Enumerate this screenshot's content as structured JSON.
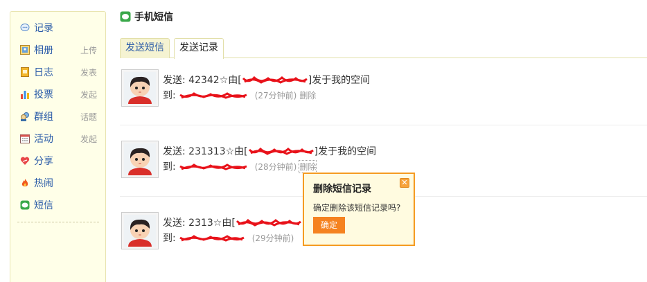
{
  "sidebar": {
    "items": [
      {
        "label": "记录",
        "action": "",
        "icon": "speech-bubble-icon"
      },
      {
        "label": "相册",
        "action": "上传",
        "icon": "photo-album-icon"
      },
      {
        "label": "日志",
        "action": "发表",
        "icon": "notebook-icon"
      },
      {
        "label": "投票",
        "action": "发起",
        "icon": "bar-chart-icon"
      },
      {
        "label": "群组",
        "action": "话题",
        "icon": "group-icon"
      },
      {
        "label": "活动",
        "action": "发起",
        "icon": "calendar-icon"
      },
      {
        "label": "分享",
        "action": "",
        "icon": "heart-icon"
      },
      {
        "label": "热闹",
        "action": "",
        "icon": "fire-icon"
      },
      {
        "label": "短信",
        "action": "",
        "icon": "sms-icon"
      }
    ]
  },
  "header": {
    "title": "手机短信"
  },
  "tabs": [
    {
      "label": "发送短信",
      "active": false
    },
    {
      "label": "发送记录",
      "active": true
    }
  ],
  "messages": [
    {
      "prefix": "发送: 42342☆由[",
      "suffix": "]发于我的空间",
      "to_label": "到:",
      "time": "(27分钟前)",
      "delete_label": "删除"
    },
    {
      "prefix": "发送: 231313☆由[",
      "suffix": "]发于我的空间",
      "to_label": "到:",
      "time": "(28分钟前)",
      "delete_label": "删除"
    },
    {
      "prefix": "发送: 2313☆由[",
      "suffix": "",
      "to_label": "到:",
      "time": "(29分钟前)",
      "delete_label": ""
    }
  ],
  "popup": {
    "title": "删除短信记录",
    "text": "确定删除该短信记录吗?",
    "confirm_label": "确定"
  },
  "colors": {
    "accent": "#f59b21",
    "link": "#2a5ba8",
    "redaction": "#e8121a"
  }
}
